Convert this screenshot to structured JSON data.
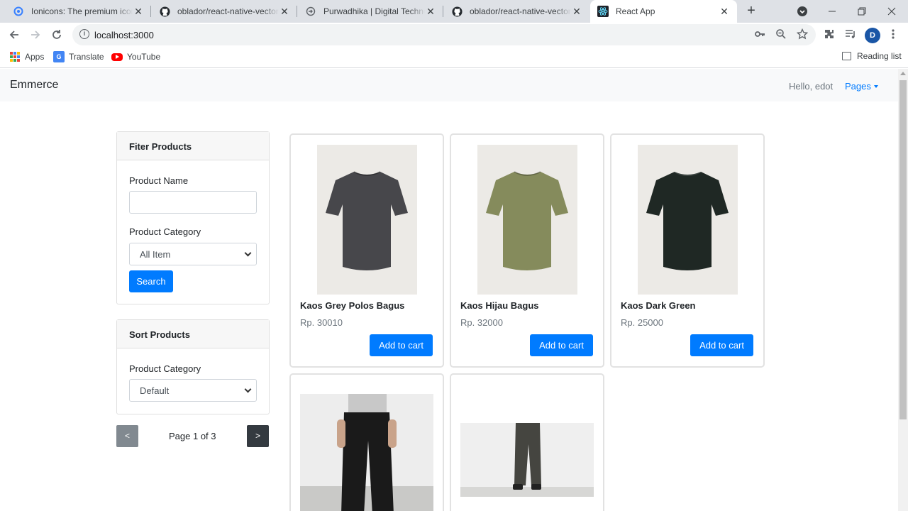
{
  "browser": {
    "tabs": [
      {
        "title": "Ionicons: The premium icon pack",
        "icon": "ionicons-icon"
      },
      {
        "title": "oblador/react-native-vector-icons",
        "icon": "github-icon"
      },
      {
        "title": "Purwadhika | Digital Technology School",
        "icon": "purwadhika-icon"
      },
      {
        "title": "oblador/react-native-vector-icons",
        "icon": "github-icon"
      },
      {
        "title": "React App",
        "icon": "react-icon"
      }
    ],
    "address": "localhost:3000",
    "avatar_letter": "D",
    "bookmarks": {
      "apps": "Apps",
      "translate": "Translate",
      "youtube": "YouTube",
      "reading_list": "Reading list"
    }
  },
  "navbar": {
    "brand": "Emmerce",
    "greeting": "Hello, edot",
    "pages_menu": "Pages"
  },
  "filter": {
    "title": "Fiter Products",
    "name_label": "Product Name",
    "name_value": "",
    "category_label": "Product Category",
    "category_value": "All Item",
    "search_label": "Search"
  },
  "sort": {
    "title": "Sort Products",
    "category_label": "Product Category",
    "category_value": "Default"
  },
  "pagination": {
    "prev": "<",
    "next": ">",
    "text": "Page 1 of 3"
  },
  "products": [
    {
      "name": "Kaos Grey Polos Bagus",
      "price": "Rp. 30010",
      "button": "Add to cart",
      "color": "#47474b"
    },
    {
      "name": "Kaos Hijau Bagus",
      "price": "Rp. 32000",
      "button": "Add to cart",
      "color": "#858b5c"
    },
    {
      "name": "Kaos Dark Green",
      "price": "Rp. 25000",
      "button": "Add to cart",
      "color": "#1f2824"
    },
    {
      "name": "",
      "price": "",
      "button": "",
      "color": "#1a1a1a"
    },
    {
      "name": "",
      "price": "",
      "button": "",
      "color": "#454540"
    }
  ],
  "colors": {
    "primary": "#007bff",
    "secondary": "#6c757d",
    "dark": "#343a40"
  }
}
